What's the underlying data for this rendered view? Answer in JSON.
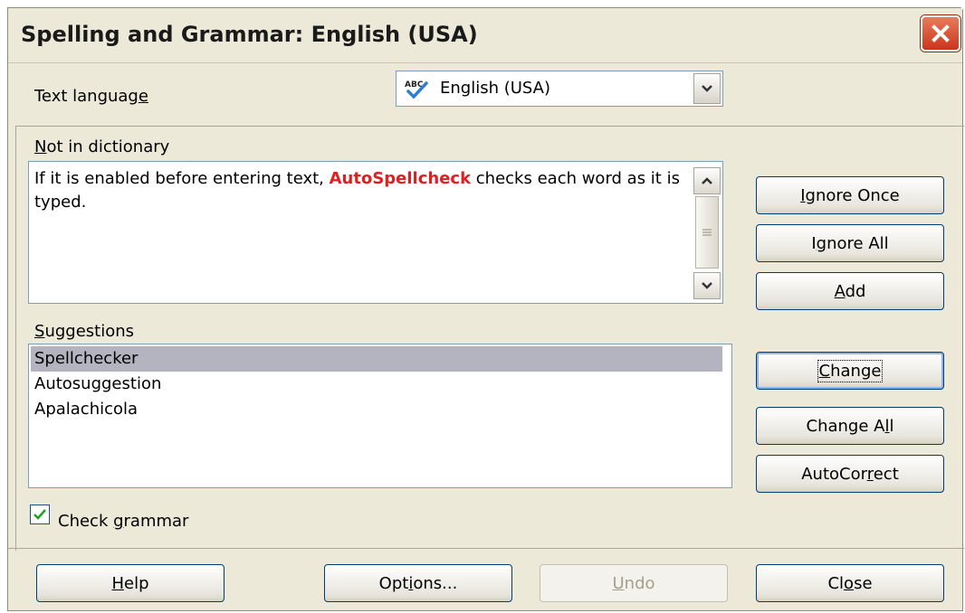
{
  "window": {
    "title": "Spelling and Grammar: English (USA)"
  },
  "text_language": {
    "label_pre": "Text languag",
    "label_accel": "e",
    "value": "English (USA)",
    "icon": "abc-check-icon"
  },
  "not_in_dictionary": {
    "label_accel": "N",
    "label_post": "ot in dictionary",
    "sentence_before": "If it is enabled before entering text, ",
    "error_word": "AutoSpellcheck",
    "sentence_after": " checks each word as it is typed."
  },
  "suggestions": {
    "label_accel": "S",
    "label_post": "uggestions",
    "items": [
      "Spellchecker",
      "Autosuggestion",
      "Apalachicola"
    ],
    "selected_index": 0
  },
  "check_grammar": {
    "pre": "Check ",
    "accel": "g",
    "post": "rammar",
    "checked": true
  },
  "side_buttons": {
    "ignore_once": {
      "pre": "",
      "accel": "I",
      "post": "gnore Once"
    },
    "ignore_all": {
      "pre": "I",
      "accel": "g",
      "post": "nore All"
    },
    "add": {
      "pre": "",
      "accel": "A",
      "post": "dd"
    },
    "change": {
      "pre": "",
      "accel": "C",
      "post": "hange"
    },
    "change_all": {
      "pre": "Change A",
      "accel": "l",
      "post": "l"
    },
    "autocorrect": {
      "pre": "AutoCor",
      "accel": "r",
      "post": "ect"
    }
  },
  "bottom_buttons": {
    "help": {
      "pre": "",
      "accel": "H",
      "post": "elp"
    },
    "options": {
      "pre": "Opt",
      "accel": "i",
      "post": "ons..."
    },
    "undo": {
      "pre": "",
      "accel": "U",
      "post": "ndo",
      "enabled": false
    },
    "close": {
      "pre": "Cl",
      "accel": "o",
      "post": "se"
    }
  },
  "colors": {
    "error_word": "#e02020",
    "selection": "#b4b3c0",
    "dialog_bg": "#ece9d8"
  }
}
